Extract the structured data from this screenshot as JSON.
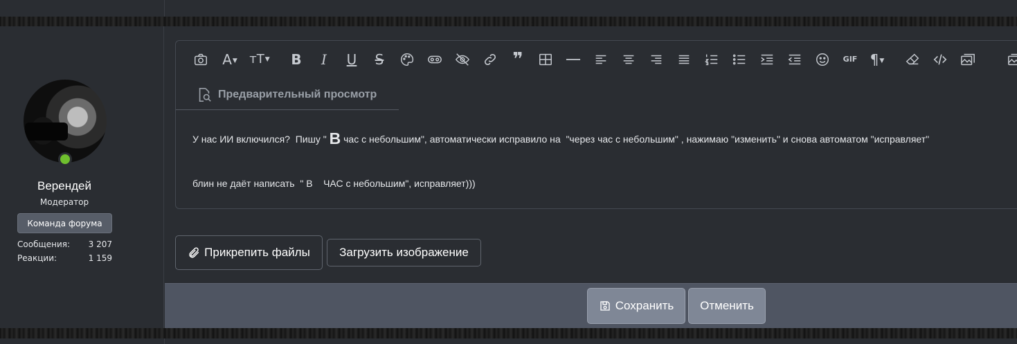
{
  "user": {
    "name": "Верендей",
    "title": "Модератор",
    "banner": "Команда форума",
    "stats": [
      {
        "label": "Сообщения:",
        "value": "3 207"
      },
      {
        "label": "Реакции:",
        "value": "1 159"
      }
    ]
  },
  "editor": {
    "toolbar_icons": [
      "camera-icon",
      "font-color-icon",
      "font-size-icon",
      "bold-icon",
      "italic-icon",
      "underline-icon",
      "strikethrough-icon",
      "palette-icon",
      "spoiler-icon",
      "hide-icon",
      "link-icon",
      "quote-icon",
      "table-icon",
      "horizontal-rule-icon",
      "align-left-icon",
      "align-center-icon",
      "align-right-icon",
      "align-justify-icon",
      "ordered-list-icon",
      "unordered-list-icon",
      "indent-icon",
      "outdent-icon",
      "smiley-icon",
      "gif-icon",
      "paragraph-icon",
      "clear-format-icon",
      "code-icon",
      "media-icon",
      "gallery-icon"
    ],
    "gif_label": "GIF",
    "preview_label": "Предварительный просмотр",
    "paragraph1_pre": "У нас ИИ включился?  Пишу \" ",
    "paragraph1_big": "В",
    "paragraph1_post": " час с небольшим\", автоматически исправило на  \"через час с небольшим\" , нажимаю \"изменить\" и снова автоматом \"исправляет\"",
    "paragraph2": "блин не даёт написать  \" В    ЧАС с небольшим\", исправляет)))"
  },
  "buttons": {
    "attach": "Прикрепить файлы",
    "upload": "Загрузить изображение",
    "save": "Сохранить",
    "cancel": "Отменить"
  },
  "colors": {
    "background": "#2a2d32",
    "footer": "#4f5562",
    "button": "#7f8796",
    "online": "#6fbf2e"
  }
}
